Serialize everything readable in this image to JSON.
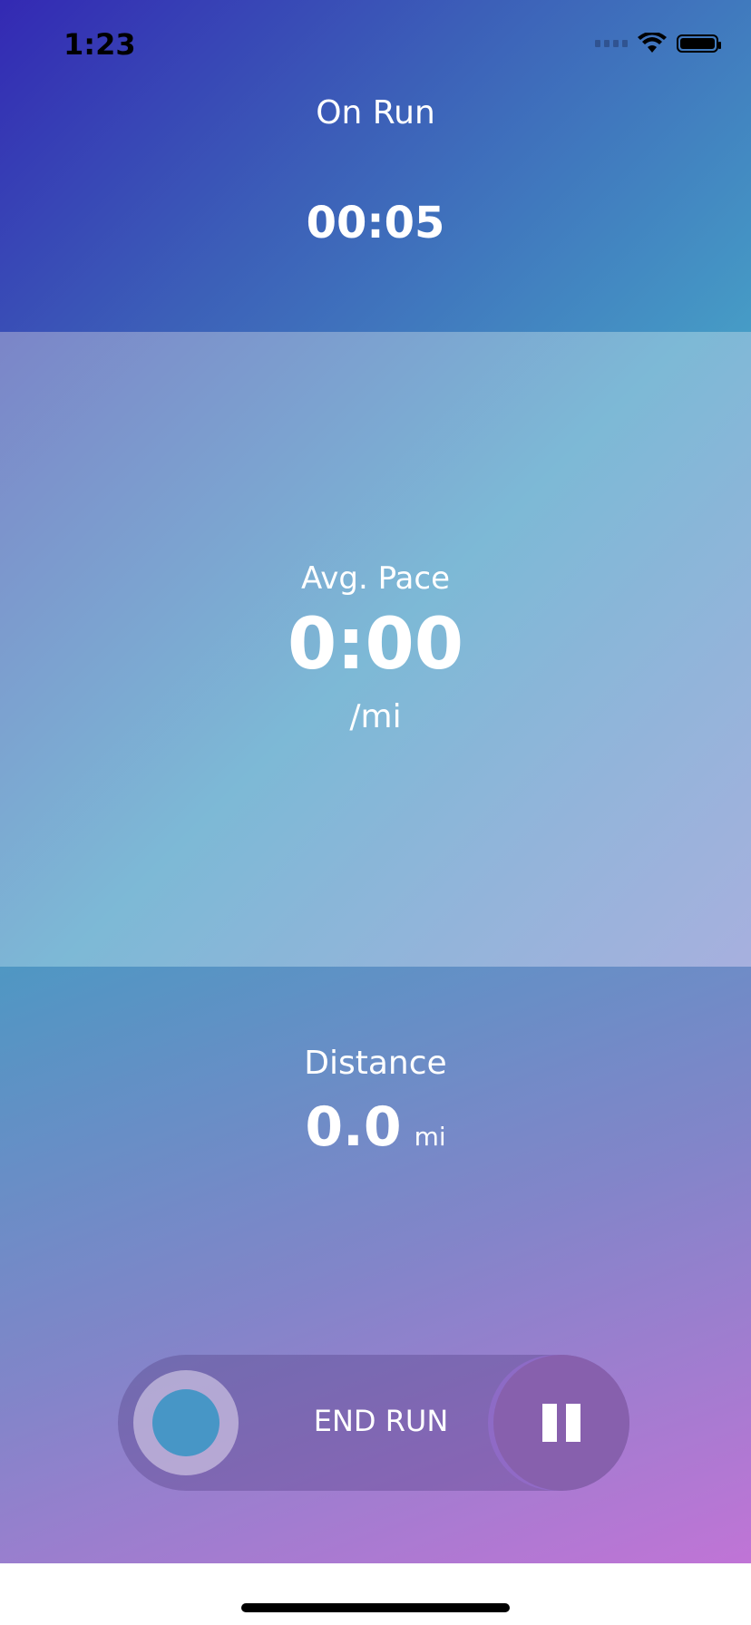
{
  "status": {
    "time": "1:23",
    "wifi_icon": "wifi-icon",
    "battery_icon": "battery-icon"
  },
  "header": {
    "title": "On Run",
    "timer": "00:05"
  },
  "pace": {
    "label": "Avg. Pace",
    "value": "0:00",
    "unit": "/mi"
  },
  "distance": {
    "label": "Distance",
    "value": "0.0",
    "unit": "mi"
  },
  "controls": {
    "end_label": "END RUN",
    "pause_icon": "pause-icon"
  },
  "colors": {
    "top_start": "#3329b3",
    "top_end": "#469cc6",
    "knob": "#4796c6",
    "pause_button": "#8760ad"
  }
}
